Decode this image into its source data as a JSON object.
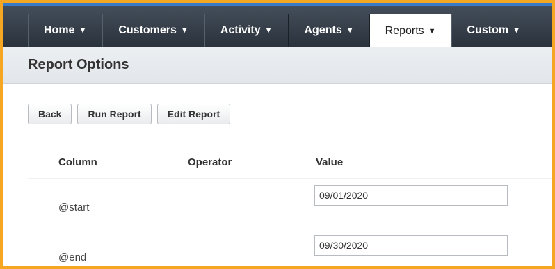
{
  "nav": {
    "tabs": [
      {
        "label": "Home",
        "caret": "▼"
      },
      {
        "label": "Customers",
        "caret": "▼"
      },
      {
        "label": "Activity",
        "caret": "▼"
      },
      {
        "label": "Agents",
        "caret": "▼"
      },
      {
        "label": "Reports",
        "caret": "▼",
        "active": true
      },
      {
        "label": "Custom",
        "caret": "▼"
      }
    ]
  },
  "page": {
    "title": "Report Options"
  },
  "actions": {
    "back": "Back",
    "run": "Run Report",
    "edit": "Edit Report"
  },
  "table": {
    "headers": {
      "column": "Column",
      "operator": "Operator",
      "value": "Value"
    },
    "rows": [
      {
        "column": "@start",
        "operator": "",
        "value": "09/01/2020"
      },
      {
        "column": "@end",
        "operator": "",
        "value": "09/30/2020"
      }
    ]
  },
  "colors": {
    "frame_border": "#f5a623",
    "nav_bg": "#2f3740",
    "accent_line": "#3a7bc8"
  }
}
